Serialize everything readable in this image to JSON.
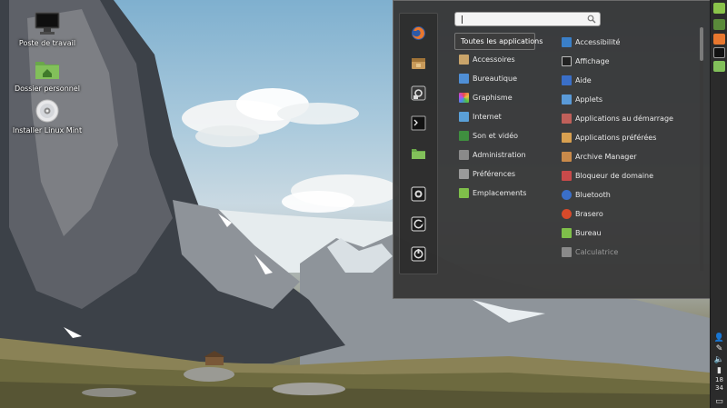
{
  "desktop": {
    "icons": [
      {
        "label": "Poste de travail",
        "icon": "computer-icon"
      },
      {
        "label": "Dossier personnel",
        "icon": "home-folder-icon"
      },
      {
        "label": "Installer Linux Mint",
        "icon": "disc-icon"
      }
    ]
  },
  "menu": {
    "search": {
      "placeholder": "",
      "value": ""
    },
    "favorites": [
      {
        "icon": "firefox-icon"
      },
      {
        "icon": "software-manager-icon"
      },
      {
        "icon": "system-settings-icon"
      },
      {
        "icon": "terminal-icon"
      },
      {
        "icon": "files-icon"
      },
      {
        "icon": "lock-screen-icon"
      },
      {
        "icon": "logout-icon"
      },
      {
        "icon": "shutdown-icon"
      }
    ],
    "categories": [
      {
        "label": "Toutes les applications",
        "selected": true
      },
      {
        "label": "Accessoires",
        "color": "#c9a46a"
      },
      {
        "label": "Bureautique",
        "color": "#4f8fd6"
      },
      {
        "label": "Graphisme",
        "color": "#d85fb0"
      },
      {
        "label": "Internet",
        "color": "#5aa0d8"
      },
      {
        "label": "Son et vidéo",
        "color": "#3f8f3f"
      },
      {
        "label": "Administration",
        "color": "#8a8a8a"
      },
      {
        "label": "Préférences",
        "color": "#9a9a9a"
      },
      {
        "label": "Emplacements",
        "color": "#7fbf4a"
      }
    ],
    "applications": [
      {
        "label": "Accessibilité",
        "color": "#3a7fc8"
      },
      {
        "label": "Affichage",
        "color": "#222222"
      },
      {
        "label": "Aide",
        "color": "#3a6fc8"
      },
      {
        "label": "Applets",
        "color": "#5a9ad8"
      },
      {
        "label": "Applications au démarrage",
        "color": "#c0605a"
      },
      {
        "label": "Applications préférées",
        "color": "#d8a050"
      },
      {
        "label": "Archive Manager",
        "color": "#c98a4a"
      },
      {
        "label": "Bloqueur de domaine",
        "color": "#c84a4a"
      },
      {
        "label": "Bluetooth",
        "color": "#3a6fc8"
      },
      {
        "label": "Brasero",
        "color": "#d84a2a"
      },
      {
        "label": "Bureau",
        "color": "#7fbf4a"
      },
      {
        "label": "Calculatrice",
        "color": "#8a8a8a"
      }
    ]
  },
  "panel": {
    "clock": {
      "hour": "18",
      "minute": "34"
    }
  }
}
